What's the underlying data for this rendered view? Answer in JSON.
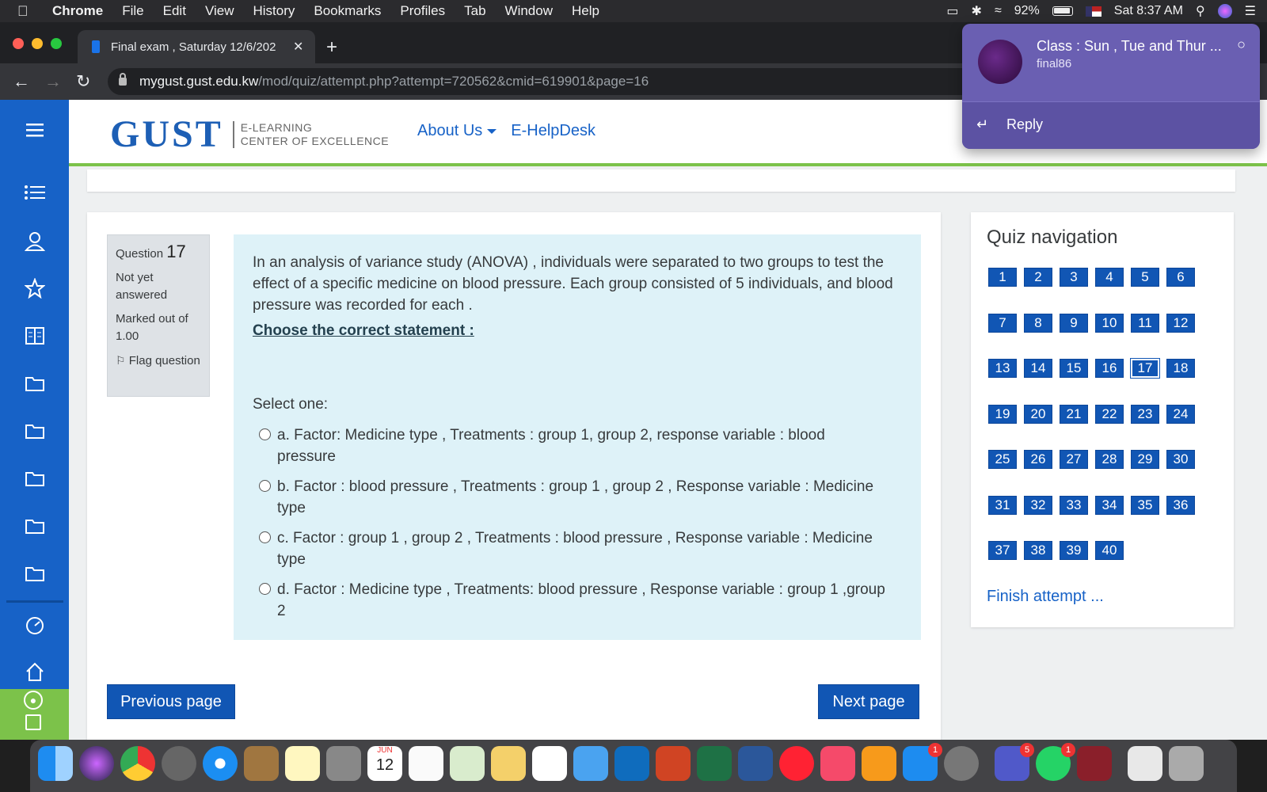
{
  "menubar": {
    "app": "Chrome",
    "items": [
      "File",
      "Edit",
      "View",
      "History",
      "Bookmarks",
      "Profiles",
      "Tab",
      "Window",
      "Help"
    ],
    "battery": "92%",
    "clock": "Sat 8:37 AM"
  },
  "browser": {
    "tab_title": "Final exam , Saturday 12/6/202",
    "url_host": "mygust.gust.edu.kw",
    "url_path": "/mod/quiz/attempt.php?attempt=720562&cmid=619901&page=16"
  },
  "header": {
    "logo_main": "GUST",
    "logo_sub1": "E-LEARNING",
    "logo_sub2": "CENTER OF EXCELLENCE",
    "nav_about": "About Us",
    "nav_helpdesk": "E-HelpDesk"
  },
  "question": {
    "label": "Question",
    "number": "17",
    "status": "Not yet answered",
    "marks": "Marked out of 1.00",
    "flag": "Flag question",
    "text": "In an analysis of variance study (ANOVA) , individuals were separated to two groups to test the effect of a specific medicine on blood pressure. Each group consisted of 5 individuals, and blood pressure was recorded for each  .",
    "prompt": "Choose the correct statement :",
    "select_label": "Select one:",
    "options": [
      "a. Factor:  Medicine type , Treatments : group 1, group 2, response variable : blood pressure",
      "b. Factor  : blood pressure , Treatments : group 1 , group 2 , Response variable : Medicine type",
      "c. Factor : group 1 , group 2  , Treatments : blood pressure , Response variable : Medicine type",
      "d. Factor : Medicine type , Treatments: blood pressure  , Response variable : group 1 ,group  2"
    ],
    "prev_button": "Previous page",
    "next_button": "Next page"
  },
  "quiz_nav": {
    "title": "Quiz navigation",
    "numbers": [
      "1",
      "2",
      "3",
      "4",
      "5",
      "6",
      "7",
      "8",
      "9",
      "10",
      "11",
      "12",
      "13",
      "14",
      "15",
      "16",
      "17",
      "18",
      "19",
      "20",
      "21",
      "22",
      "23",
      "24",
      "25",
      "26",
      "27",
      "28",
      "29",
      "30",
      "31",
      "32",
      "33",
      "34",
      "35",
      "36",
      "37",
      "38",
      "39",
      "40"
    ],
    "current": "17",
    "finish": "Finish attempt ..."
  },
  "notification": {
    "title": "Class : Sun , Tue and Thur ...",
    "subtitle": "final86",
    "reply": "Reply"
  },
  "dock": {
    "calendar_month": "JUN",
    "calendar_day": "12",
    "badges": [
      "1",
      "5",
      "1"
    ]
  },
  "colors": {
    "sidebar": "#1762c7",
    "accent_green": "#7cc24a",
    "question_bg": "#def2f8",
    "button_blue": "#1156b4",
    "notification": "#6a5fb2"
  }
}
